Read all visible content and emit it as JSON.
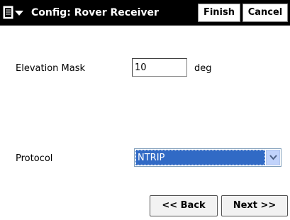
{
  "header": {
    "title": "Config: Rover Receiver",
    "finish_label": "Finish",
    "cancel_label": "Cancel",
    "menu_icon": "start-menu-icon"
  },
  "form": {
    "elevation_mask": {
      "label": "Elevation Mask",
      "value": "10",
      "unit": "deg"
    },
    "protocol": {
      "label": "Protocol",
      "selected": "NTRIP"
    }
  },
  "navigation": {
    "back_label": "<< Back",
    "next_label": "Next >>"
  },
  "colors": {
    "titlebar_bg": "#000000",
    "selection": "#316ac5",
    "dropdown_button": "#c1d3fb"
  }
}
